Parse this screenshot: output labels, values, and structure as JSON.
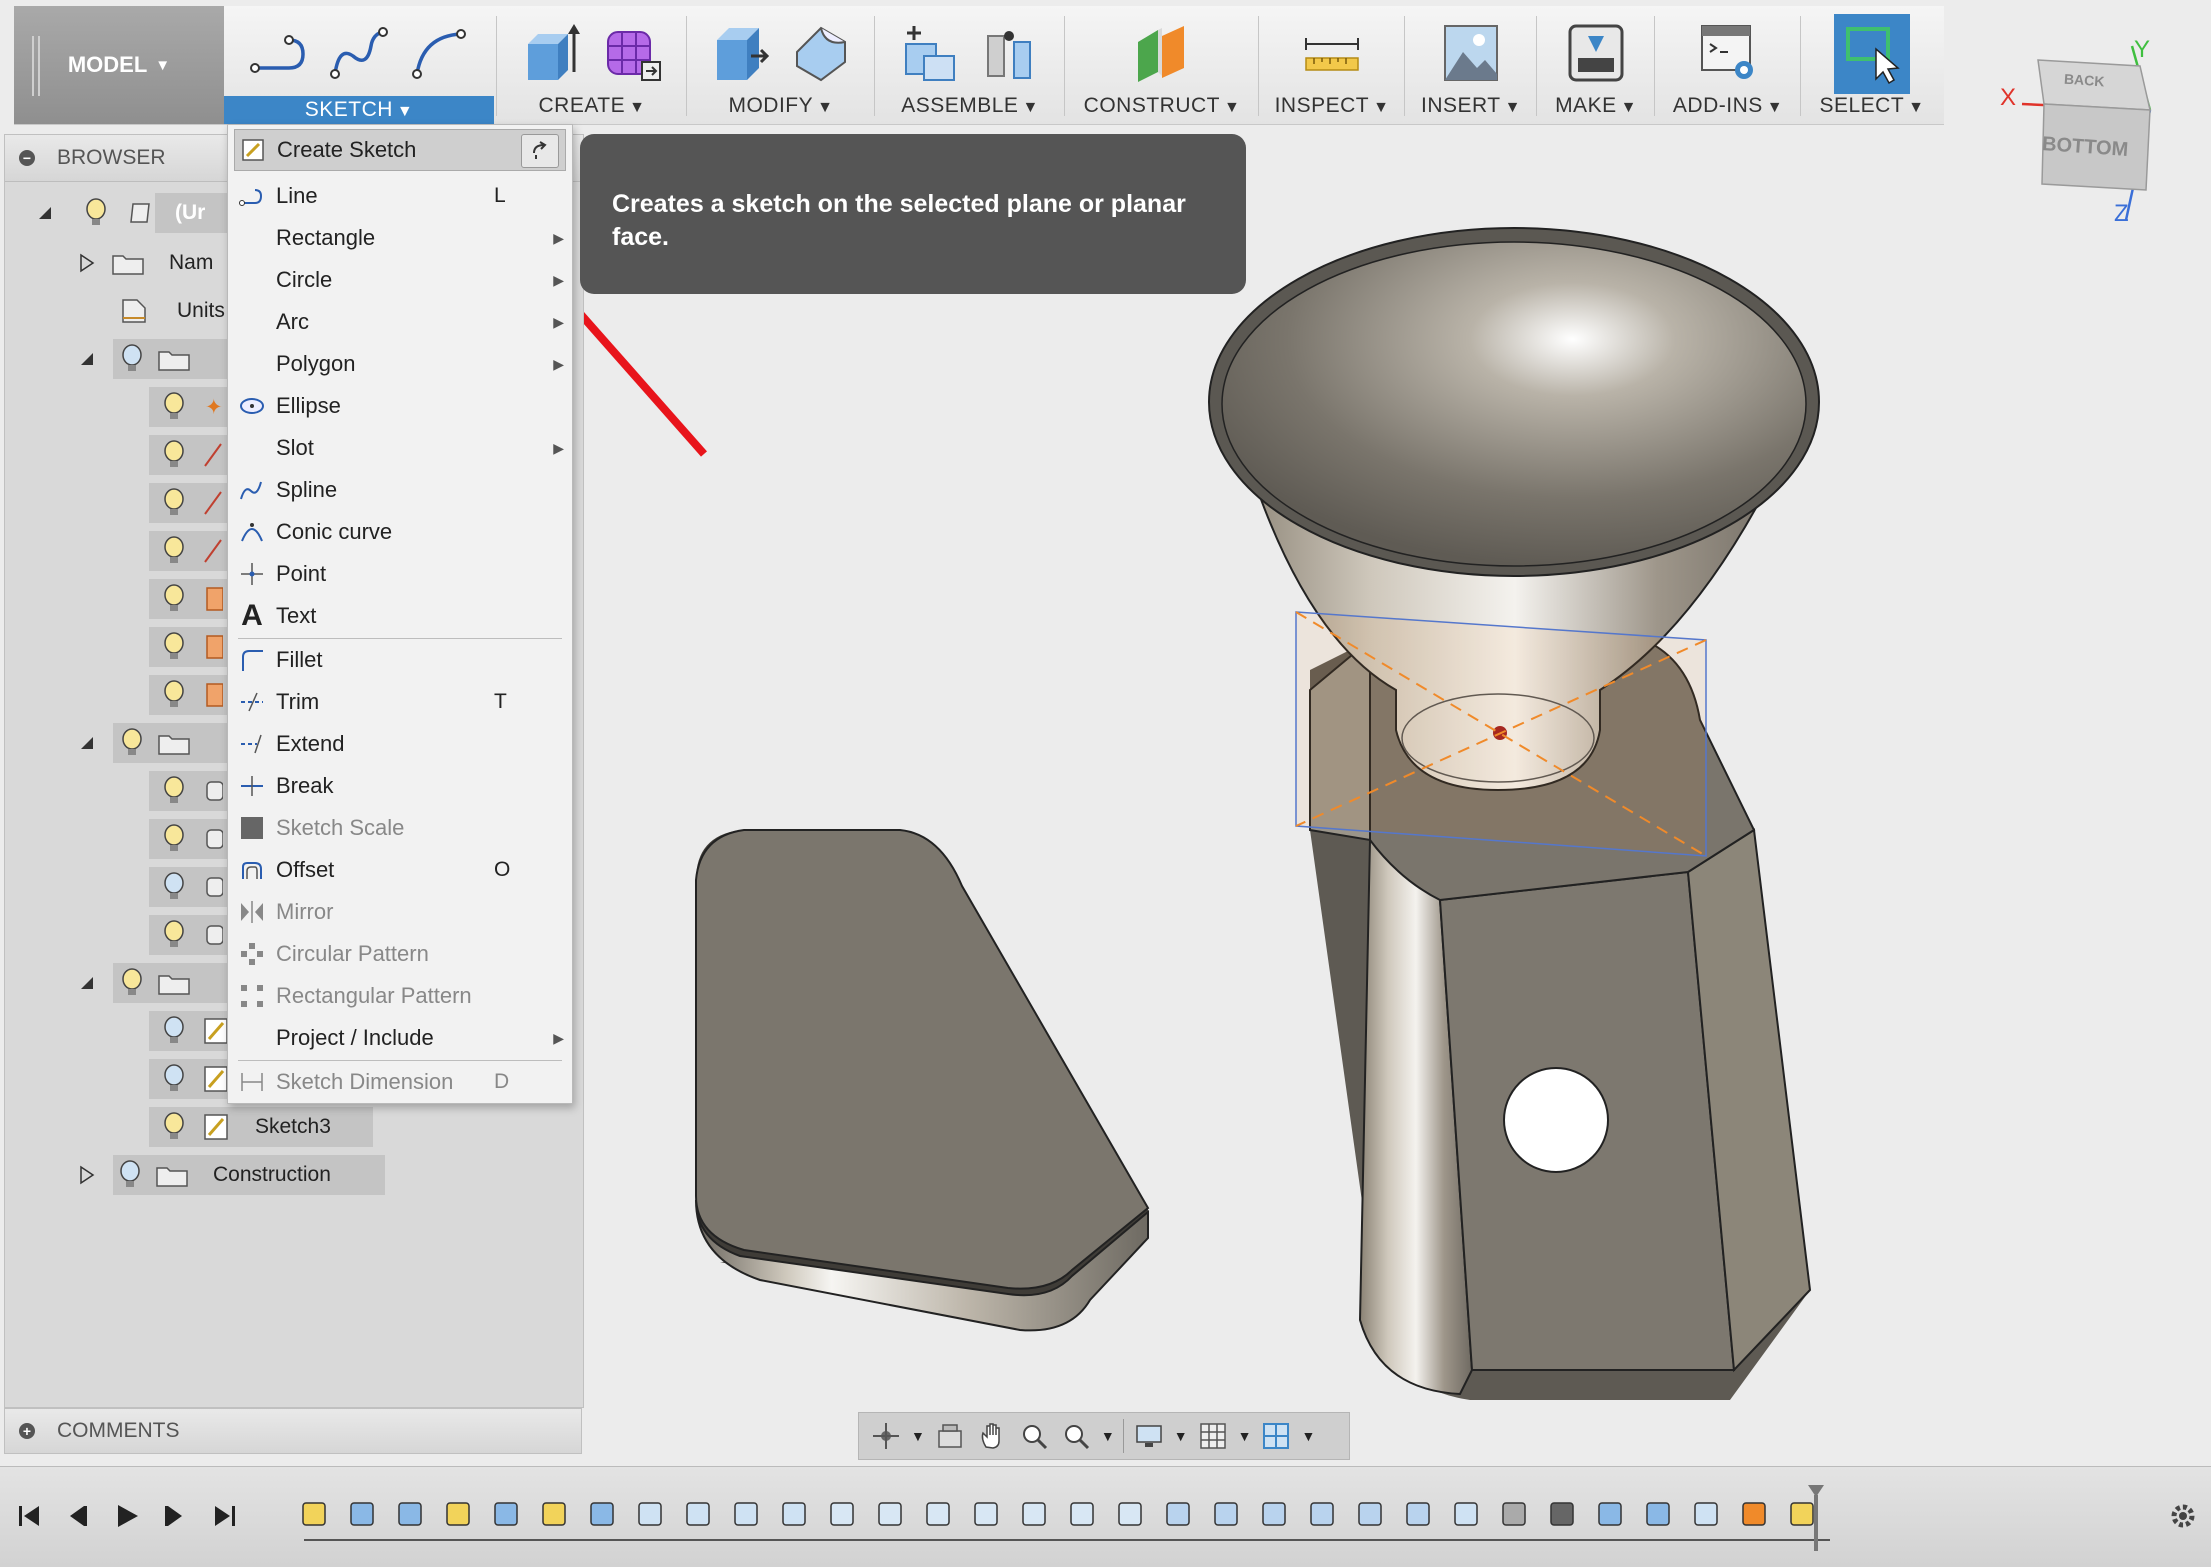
{
  "toolbar": {
    "workspace": "MODEL",
    "groups": [
      {
        "label": "SKETCH",
        "icons": [
          "line-icon",
          "spline-icon",
          "arc-icon"
        ],
        "active": true
      },
      {
        "label": "CREATE",
        "icons": [
          "extrude-icon",
          "form-icon"
        ]
      },
      {
        "label": "MODIFY",
        "icons": [
          "press-pull-icon",
          "fillet-icon"
        ]
      },
      {
        "label": "ASSEMBLE",
        "icons": [
          "new-component-icon",
          "joint-icon"
        ]
      },
      {
        "label": "CONSTRUCT",
        "icons": [
          "offset-plane-icon"
        ]
      },
      {
        "label": "INSPECT",
        "icons": [
          "measure-icon"
        ]
      },
      {
        "label": "INSERT",
        "icons": [
          "insert-image-icon"
        ]
      },
      {
        "label": "MAKE",
        "icons": [
          "3d-print-icon"
        ]
      },
      {
        "label": "ADD-INS",
        "icons": [
          "scripts-icon"
        ]
      },
      {
        "label": "SELECT",
        "icons": [
          "select-icon"
        ]
      }
    ]
  },
  "viewcube": {
    "top_face": "BACK",
    "front_face": "BOTTOM",
    "axis_x": "X",
    "axis_y": "Y",
    "axis_z": "Z",
    "color_x": "#e0332a",
    "color_y": "#3fbf3f",
    "color_z": "#3a6fd8"
  },
  "browser": {
    "title": "BROWSER",
    "root_label": "(Ur",
    "named_views": "Nam",
    "units": "Units",
    "sketch3": "Sketch3",
    "construction": "Construction"
  },
  "comments": {
    "title": "COMMENTS"
  },
  "sketch_menu": {
    "items": [
      {
        "label": "Create Sketch",
        "icon": "create-sketch-icon",
        "shortcut": "",
        "submenu": false,
        "disabled": false,
        "highlight": true
      },
      {
        "label": "Line",
        "icon": "line-icon",
        "shortcut": "L",
        "submenu": false,
        "disabled": false
      },
      {
        "label": "Rectangle",
        "icon": "",
        "shortcut": "",
        "submenu": true,
        "disabled": false
      },
      {
        "label": "Circle",
        "icon": "",
        "shortcut": "",
        "submenu": true,
        "disabled": false
      },
      {
        "label": "Arc",
        "icon": "",
        "shortcut": "",
        "submenu": true,
        "disabled": false
      },
      {
        "label": "Polygon",
        "icon": "",
        "shortcut": "",
        "submenu": true,
        "disabled": false
      },
      {
        "label": "Ellipse",
        "icon": "ellipse-icon",
        "shortcut": "",
        "submenu": false,
        "disabled": false
      },
      {
        "label": "Slot",
        "icon": "",
        "shortcut": "",
        "submenu": true,
        "disabled": false
      },
      {
        "label": "Spline",
        "icon": "spline-icon",
        "shortcut": "",
        "submenu": false,
        "disabled": false
      },
      {
        "label": "Conic curve",
        "icon": "conic-curve-icon",
        "shortcut": "",
        "submenu": false,
        "disabled": false
      },
      {
        "label": "Point",
        "icon": "point-icon",
        "shortcut": "",
        "submenu": false,
        "disabled": false
      },
      {
        "label": "Text",
        "icon": "text-icon",
        "shortcut": "",
        "submenu": false,
        "disabled": false
      },
      {
        "label": "Fillet",
        "icon": "sketch-fillet-icon",
        "shortcut": "",
        "submenu": false,
        "disabled": false
      },
      {
        "label": "Trim",
        "icon": "trim-icon",
        "shortcut": "T",
        "submenu": false,
        "disabled": false
      },
      {
        "label": "Extend",
        "icon": "extend-icon",
        "shortcut": "",
        "submenu": false,
        "disabled": false
      },
      {
        "label": "Break",
        "icon": "break-icon",
        "shortcut": "",
        "submenu": false,
        "disabled": false
      },
      {
        "label": "Sketch Scale",
        "icon": "sketch-scale-icon",
        "shortcut": "",
        "submenu": false,
        "disabled": true
      },
      {
        "label": "Offset",
        "icon": "offset-icon",
        "shortcut": "O",
        "submenu": false,
        "disabled": false
      },
      {
        "label": "Mirror",
        "icon": "mirror-icon",
        "shortcut": "",
        "submenu": false,
        "disabled": true
      },
      {
        "label": "Circular Pattern",
        "icon": "circular-pattern-icon",
        "shortcut": "",
        "submenu": false,
        "disabled": true
      },
      {
        "label": "Rectangular Pattern",
        "icon": "rectangular-pattern-icon",
        "shortcut": "",
        "submenu": false,
        "disabled": true
      },
      {
        "label": "Project / Include",
        "icon": "",
        "shortcut": "",
        "submenu": true,
        "disabled": false
      },
      {
        "label": "Sketch Dimension",
        "icon": "sketch-dimension-icon",
        "shortcut": "D",
        "submenu": false,
        "disabled": true
      }
    ]
  },
  "tooltip": {
    "text": "Creates a sketch on the selected plane or planar face."
  },
  "colors": {
    "accent": "#3c86c7",
    "annotation_arrow": "#e8141b",
    "tooltip_bg": "#555555"
  }
}
